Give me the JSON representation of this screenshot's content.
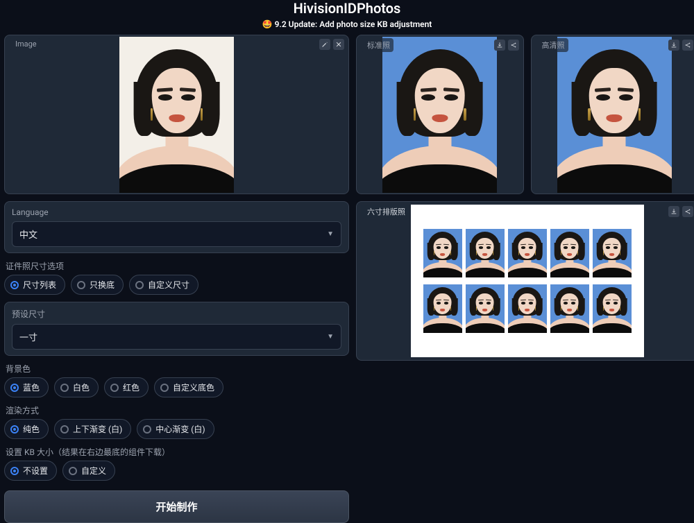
{
  "header": {
    "title": "HivisionIDPhotos",
    "subtitle_emoji": "🤩",
    "subtitle": "9.2 Update: Add photo size KB adjustment"
  },
  "panels": {
    "input_label": "Image",
    "standard_label": "标准照",
    "hd_label": "高清照",
    "layout_label": "六寸排版照"
  },
  "icons": {
    "image": "image-icon",
    "edit": "pencil-icon",
    "close": "x-icon",
    "download": "download-icon",
    "share": "share-icon"
  },
  "controls": {
    "language_label": "Language",
    "language_value": "中文",
    "size_option_label": "证件照尺寸选项",
    "size_options": [
      {
        "label": "尺寸列表",
        "selected": true
      },
      {
        "label": "只换底",
        "selected": false
      },
      {
        "label": "自定义尺寸",
        "selected": false
      }
    ],
    "preset_label": "预设尺寸",
    "preset_value": "一寸",
    "bg_label": "背景色",
    "bg_options": [
      {
        "label": "蓝色",
        "selected": true
      },
      {
        "label": "白色",
        "selected": false
      },
      {
        "label": "红色",
        "selected": false
      },
      {
        "label": "自定义底色",
        "selected": false
      }
    ],
    "render_label": "渲染方式",
    "render_options": [
      {
        "label": "纯色",
        "selected": true
      },
      {
        "label": "上下渐变 (白)",
        "selected": false
      },
      {
        "label": "中心渐变 (白)",
        "selected": false
      }
    ],
    "kb_label": "设置 KB 大小（结果在右边最底的组件下载）",
    "kb_options": [
      {
        "label": "不设置",
        "selected": true
      },
      {
        "label": "自定义",
        "selected": false
      }
    ],
    "submit": "开始制作"
  }
}
